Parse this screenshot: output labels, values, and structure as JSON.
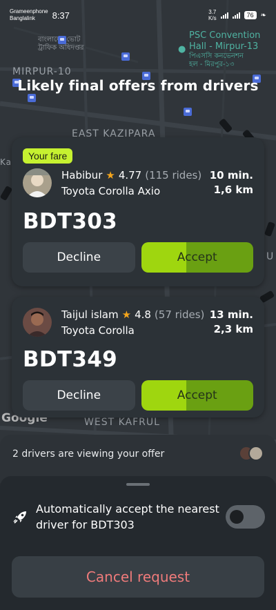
{
  "status_bar": {
    "carrier_1": "Grameenphone",
    "carrier_2": "Banglalink",
    "time": "8:37",
    "speed_value": "3.7",
    "speed_unit": "K/s",
    "battery": "76"
  },
  "map": {
    "labels": {
      "mirpur_10": "MIRPUR-10",
      "east_kazipara": "EAST KAZIPARA",
      "west_kafrul": "WEST KAFRUL",
      "psc_line1": "PSC Convention",
      "psc_line2": "Hall - Mirpur-13",
      "psc_bn1": "পিএসসি কনভেনশন",
      "psc_bn2": "হল - মিরপুর-১৩",
      "bn_top1": "বাংলাদেশ ভোট",
      "bn_top2": "ট্রাফিক অধিদপ্তর",
      "edge_left": "Ka",
      "edge_right": "U"
    },
    "watermark": "Google"
  },
  "headline": "Likely final offers from drivers",
  "offers": [
    {
      "badge": "Your fare",
      "driver_name": "Habibur",
      "rating": "4.77",
      "rides": "(115 rides)",
      "car": "Toyota Corolla Axio",
      "eta_time": "10 min.",
      "eta_distance": "1,6 km",
      "price": "BDT303",
      "decline_label": "Decline",
      "accept_label": "Accept"
    },
    {
      "driver_name": "Taijul islam",
      "rating": "4.8",
      "rides": "(57 rides)",
      "car": "Toyota Corolla",
      "eta_time": "13 min.",
      "eta_distance": "2,3 km",
      "price": "BDT349",
      "decline_label": "Decline",
      "accept_label": "Accept"
    }
  ],
  "viewing": {
    "text": "2 drivers are viewing your offer"
  },
  "auto_accept": {
    "text": "Automatically accept the nearest driver for BDT303",
    "enabled": false
  },
  "cancel_label": "Cancel request",
  "colors": {
    "accent_green": "#9fd60f",
    "badge_green": "#c6f130",
    "cancel_red": "#f07b7b",
    "star": "#f4a51c"
  },
  "icons": {
    "star": "star-icon",
    "rocket": "rocket-icon",
    "bus_stop": "bus-stop-icon",
    "car": "car-icon"
  }
}
